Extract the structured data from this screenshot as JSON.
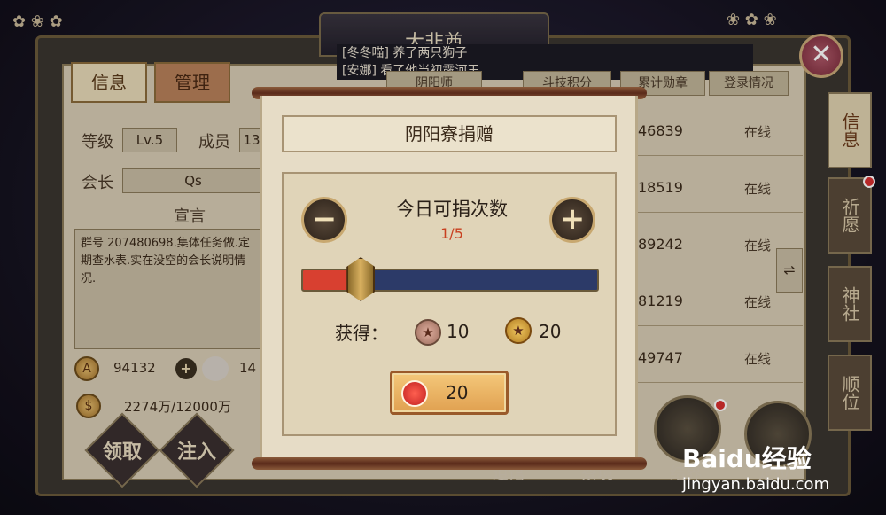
{
  "background": {
    "title": "大非酋",
    "close_icon": "close-icon",
    "news": [
      "[冬冬喵] 养了两只狗子",
      "[安娜] 看了他当初露河王"
    ],
    "tabs": [
      {
        "label": "信息"
      },
      {
        "label": "管理"
      }
    ],
    "level_label": "等级",
    "level_value": "Lv.5",
    "members_label": "成员",
    "members_value": "13",
    "leader_label": "会长",
    "leader_value": "Qs",
    "declaration_label": "宣言",
    "declaration_text": "群号 207480698.集体任务做.定期查水表.实在没空的会长说明情况.",
    "stat1_value": "94132",
    "stat2_value": "14",
    "funds_value": "2274万/12000万",
    "action_buttons": [
      "领取",
      "注入"
    ],
    "table_headers": [
      "阴阳师",
      "斗技积分",
      "累计勋章",
      "登录情况"
    ],
    "table_rows": [
      {
        "num": "46839",
        "status": "在线"
      },
      {
        "num": "18519",
        "status": "在线"
      },
      {
        "num": "89242",
        "status": "在线"
      },
      {
        "num": "81219",
        "status": "在线"
      },
      {
        "num": "49747",
        "status": "在线"
      }
    ],
    "side_tabs": [
      {
        "label": "信息"
      },
      {
        "label": "祈愿"
      },
      {
        "label": "神社"
      },
      {
        "label": "顺位"
      }
    ],
    "bottom_labels": [
      "道馆",
      "寮境",
      "结界",
      "定位"
    ]
  },
  "modal": {
    "title": "阴阳寮捐赠",
    "count_label": "今日可捐次数",
    "count_value": "1/5",
    "slider_level": 0.2,
    "minus_icon": "minus-icon",
    "plus_icon": "plus-icon",
    "gain_label": "获得：",
    "rewards": [
      {
        "icon": "bronze-medal-icon",
        "value": "10"
      },
      {
        "icon": "gold-medal-icon",
        "value": "20"
      }
    ],
    "donate_cost": "20"
  },
  "watermark": {
    "text": "Baidu经验",
    "sub": "jingyan.baidu.com"
  }
}
